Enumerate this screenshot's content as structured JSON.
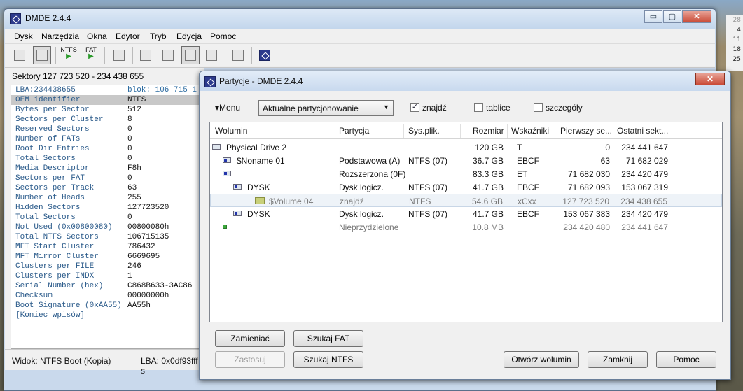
{
  "main_window": {
    "title": "DMDE 2.4.4",
    "controls": {
      "minimize": "▭",
      "maximize": "▢",
      "close": "✕"
    },
    "menu": [
      "Dysk",
      "Narzędzia",
      "Okna",
      "Edytor",
      "Tryb",
      "Edycja",
      "Pomoc"
    ],
    "toolbar": {
      "ntfs_label": "NTFS",
      "fat_label": "FAT",
      "arrow": "▶"
    },
    "sectors_header": "Sektory 127 723 520 - 234 438 655",
    "hex_header": {
      "lba": "LBA:234438655",
      "blok": "blok: 106 715 1"
    },
    "boot_fields": [
      {
        "key": "OEM identifier",
        "value": "NTFS"
      },
      {
        "key": "Bytes per Sector",
        "value": "512"
      },
      {
        "key": "Sectors per Cluster",
        "value": "8"
      },
      {
        "key": "Reserved Sectors",
        "value": "0"
      },
      {
        "key": "Number of FATs",
        "value": "0"
      },
      {
        "key": "Root Dir Entries",
        "value": "0"
      },
      {
        "key": "Total Sectors",
        "value": "0"
      },
      {
        "key": "Media Descriptor",
        "value": "F8h"
      },
      {
        "key": "Sectors per FAT",
        "value": "0"
      },
      {
        "key": "Sectors per Track",
        "value": "63"
      },
      {
        "key": "Number of Heads",
        "value": "255"
      },
      {
        "key": "Hidden Sectors",
        "value": "127723520"
      },
      {
        "key": "Total Sectors",
        "value": "0"
      },
      {
        "key": "Not Used (0x00800080)",
        "value": "00800080h"
      },
      {
        "key": "Total NTFS Sectors",
        "value": "106715135"
      },
      {
        "key": "MFT Start Cluster",
        "value": "786432"
      },
      {
        "key": "MFT Mirror Cluster",
        "value": "6669695"
      },
      {
        "key": "Clusters per FILE",
        "value": "246"
      },
      {
        "key": "Clusters per INDX",
        "value": "1"
      },
      {
        "key": "Serial Number (hex)",
        "value": "C868B633-3AC86"
      },
      {
        "key": "Checksum",
        "value": "00000000h"
      },
      {
        "key": "Boot Signature (0xAA55)",
        "value": "AA55h"
      },
      {
        "key": "[Koniec wpisów]",
        "value": ""
      }
    ],
    "status": {
      "view": "Widok: NTFS Boot (Kopia)",
      "lba": "LBA: 0x0df93fff s"
    }
  },
  "calendar": [
    "28",
    "4",
    "11",
    "18",
    "25"
  ],
  "dialog": {
    "title": "Partycje - DMDE 2.4.4",
    "close": "✕",
    "menu_button": "▾Menu",
    "mode_select": "Aktualne partycjonowanie",
    "checkboxes": [
      {
        "label": "znajdź",
        "checked": true
      },
      {
        "label": "tablice",
        "checked": false
      },
      {
        "label": "szczegóły",
        "checked": false
      }
    ],
    "columns": [
      "Wolumin",
      "Partycja",
      "Sys.plik.",
      "Rozmiar",
      "Wskaźniki",
      "Pierwszy se...",
      "Ostatni sekt..."
    ],
    "rows": [
      {
        "name": "Physical Drive 2",
        "part": "",
        "fs": "",
        "size": "120 GB",
        "flags": "T",
        "first": "0",
        "last": "234 441 647",
        "icon": "drive-icon"
      },
      {
        "name": "$Noname 01",
        "part": "Podstawowa (A)",
        "fs": "NTFS (07)",
        "size": "36.7 GB",
        "flags": "EBCF",
        "first": "63",
        "last": "71 682 029",
        "icon": "partition-icon"
      },
      {
        "name": "",
        "part": "Rozszerzona  (0F)",
        "fs": "",
        "size": "83.3 GB",
        "flags": "ET",
        "first": "71 682 030",
        "last": "234 420 479",
        "icon": "partition-icon"
      },
      {
        "name": "DYSK",
        "part": "Dysk logicz.",
        "fs": "NTFS (07)",
        "size": "41.7 GB",
        "flags": "EBCF",
        "first": "71 682 093",
        "last": "153 067 319",
        "icon": "partition-icon"
      },
      {
        "name": "$Volume 04",
        "part": "znajdź",
        "fs": "NTFS",
        "size": "54.6 GB",
        "flags": "xCxx",
        "first": "127 723 520",
        "last": "234 438 655",
        "icon": "folder-icon"
      },
      {
        "name": "DYSK",
        "part": "Dysk logicz.",
        "fs": "NTFS (07)",
        "size": "41.7 GB",
        "flags": "EBCF",
        "first": "153 067 383",
        "last": "234 420 479",
        "icon": "partition-icon"
      },
      {
        "name": "",
        "part": "Nieprzydzielone",
        "fs": "",
        "size": "10.8 MB",
        "flags": "",
        "first": "234 420 480",
        "last": "234 441 647",
        "icon": "free-space-icon"
      }
    ],
    "buttons": {
      "swap": "Zamieniać",
      "search_fat": "Szukaj FAT",
      "apply": "Zastosuj",
      "search_ntfs": "Szukaj NTFS",
      "open_volume": "Otwórz wolumin",
      "close": "Zamknij",
      "help": "Pomoc"
    }
  }
}
